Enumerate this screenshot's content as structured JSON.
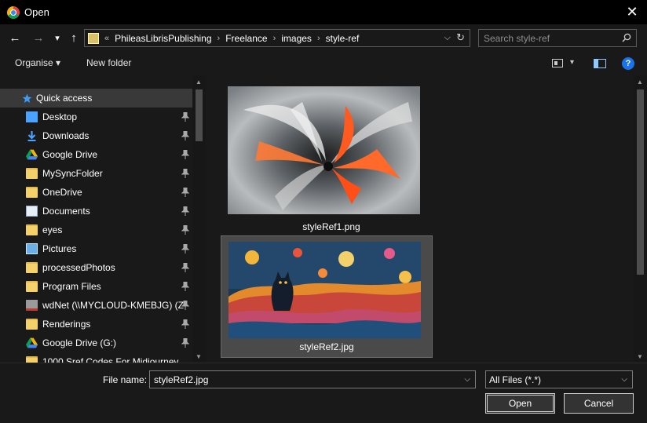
{
  "window": {
    "title": "Open",
    "close_glyph": "✕"
  },
  "nav": {
    "back_glyph": "←",
    "forward_glyph": "→",
    "recent_glyph": "▾",
    "up_glyph": "↑",
    "overflow": "«",
    "breadcrumbs": [
      "PhileasLibrisPublishing",
      "Freelance",
      "images",
      "style-ref"
    ],
    "separator": "›",
    "addr_dropdown_glyph": "⌵",
    "refresh_glyph": "↻",
    "search_placeholder": "Search style-ref"
  },
  "toolbar": {
    "organise_label": "Organise ▾",
    "new_folder_label": "New folder",
    "view_chevron": "▾",
    "help_label": "?"
  },
  "sidebar": {
    "items": [
      {
        "label": "Quick access",
        "icon": "star-icon"
      },
      {
        "label": "Desktop",
        "icon": "desktop-icon"
      },
      {
        "label": "Downloads",
        "icon": "download-icon"
      },
      {
        "label": "Google Drive",
        "icon": "google-drive-icon"
      },
      {
        "label": "MySyncFolder",
        "icon": "folder-icon"
      },
      {
        "label": "OneDrive",
        "icon": "folder-icon"
      },
      {
        "label": "Documents",
        "icon": "documents-icon"
      },
      {
        "label": "eyes",
        "icon": "folder-icon"
      },
      {
        "label": "Pictures",
        "icon": "pictures-icon"
      },
      {
        "label": "processedPhotos",
        "icon": "folder-icon"
      },
      {
        "label": "Program Files",
        "icon": "folder-icon"
      },
      {
        "label": "wdNet (\\\\MYCLOUD-KMEBJG) (Z",
        "icon": "network-drive-icon"
      },
      {
        "label": "Renderings",
        "icon": "folder-icon"
      },
      {
        "label": "Google Drive (G:)",
        "icon": "google-drive-icon"
      },
      {
        "label": "1000 Sref Codes For Midjourney",
        "icon": "folder-icon"
      }
    ]
  },
  "files": [
    {
      "name": "styleRef1.png",
      "selected": false
    },
    {
      "name": "styleRef2.jpg",
      "selected": true
    }
  ],
  "footer": {
    "file_name_label": "File name:",
    "file_name_value": "styleRef2.jpg",
    "file_type_value": "All Files (*.*)",
    "dropdown_glyph": "⌵",
    "open_label": "Open",
    "cancel_label": "Cancel"
  },
  "scroll": {
    "up_glyph": "▲",
    "down_glyph": "▼"
  },
  "colors": {
    "background": "#191919",
    "selected": "#393939",
    "accent": "#1a73e8"
  }
}
